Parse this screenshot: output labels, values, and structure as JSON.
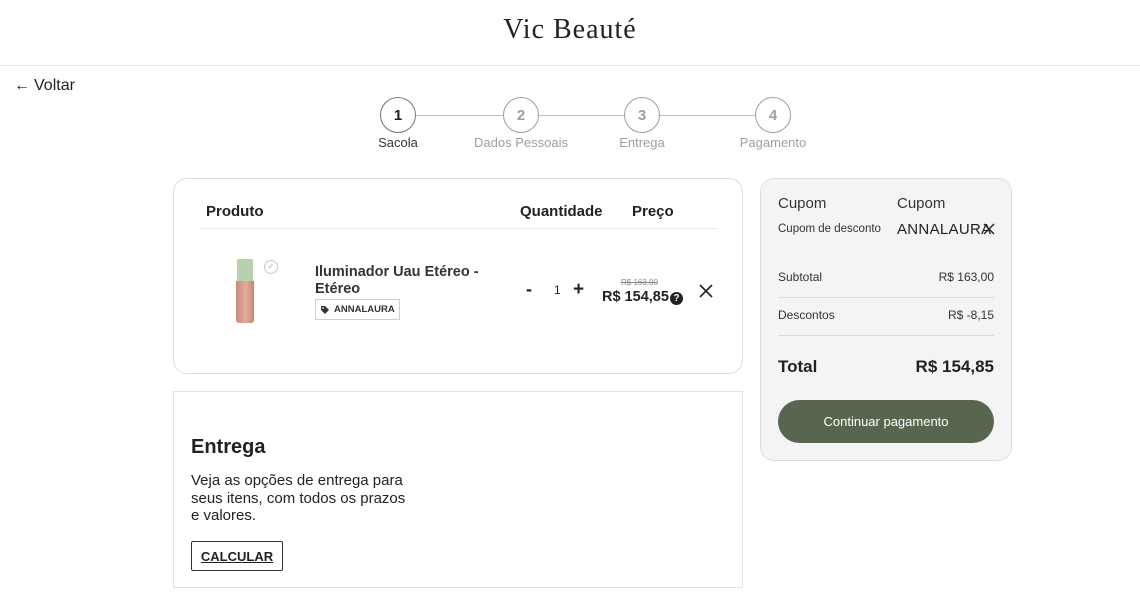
{
  "header": {
    "brand": "Vic Beauté"
  },
  "nav": {
    "back_label": "Voltar"
  },
  "stepper": {
    "steps": [
      {
        "number": "1",
        "label": "Sacola"
      },
      {
        "number": "2",
        "label": "Dados Pessoais"
      },
      {
        "number": "3",
        "label": "Entrega"
      },
      {
        "number": "4",
        "label": "Pagamento"
      }
    ],
    "active_step": "1"
  },
  "cart": {
    "headers": {
      "product": "Produto",
      "quantity": "Quantidade",
      "price": "Preço"
    },
    "items": [
      {
        "name": "Iluminador Uau Etéreo - Etéreo",
        "coupon": "ANNALAURA",
        "quantity": "1",
        "minus": "-",
        "plus": "+",
        "old_price": "R$ 163,00",
        "price": "R$ 154,85",
        "help": "?"
      }
    ]
  },
  "shipping": {
    "title": "Entrega",
    "text": "Veja as opções de entrega para seus itens, com todos os prazos e valores.",
    "button": "CALCULAR"
  },
  "summary": {
    "coupon_label": "Cupom",
    "coupon_desc": "Cupom de desconto",
    "coupon_label_2": "Cupom",
    "coupon_code": "ANNALAURA",
    "subtotal_label": "Subtotal",
    "subtotal_value": "R$ 163,00",
    "discount_label": "Descontos",
    "discount_value": "R$ -8,15",
    "total_label": "Total",
    "total_value": "R$ 154,85",
    "pay_button": "Continuar pagamento"
  },
  "colors": {
    "accent": "#59664f",
    "summary_bg": "#f4f4f4",
    "product_cap": "#b9d0b0",
    "product_body": "#e3ad98"
  }
}
